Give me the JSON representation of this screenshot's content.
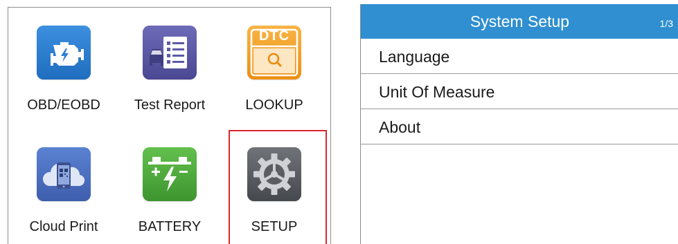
{
  "main_menu": {
    "tiles": [
      {
        "label": "OBD/EOBD",
        "icon": "engine-icon",
        "color": "#2f7fd1"
      },
      {
        "label": "Test Report",
        "icon": "test-report-icon",
        "color": "#5c5aa8"
      },
      {
        "label": "LOOKUP",
        "icon": "dtc-lookup-icon",
        "icon_text": "DTC",
        "color": "#f4a125"
      },
      {
        "label": "Cloud Print",
        "icon": "cloud-print-icon",
        "color": "#4d6fc0"
      },
      {
        "label": "BATTERY",
        "icon": "battery-icon",
        "color": "#4fae3e"
      },
      {
        "label": "SETUP",
        "icon": "gear-icon",
        "color": "#5a5d62",
        "selected": true
      }
    ],
    "selection_color": "#d8262e"
  },
  "system_setup": {
    "title": "System Setup",
    "page_indicator": "1/3",
    "header_color": "#2f8fd0",
    "items": [
      {
        "label": "Language"
      },
      {
        "label": "Unit Of Measure"
      },
      {
        "label": "About"
      }
    ]
  }
}
